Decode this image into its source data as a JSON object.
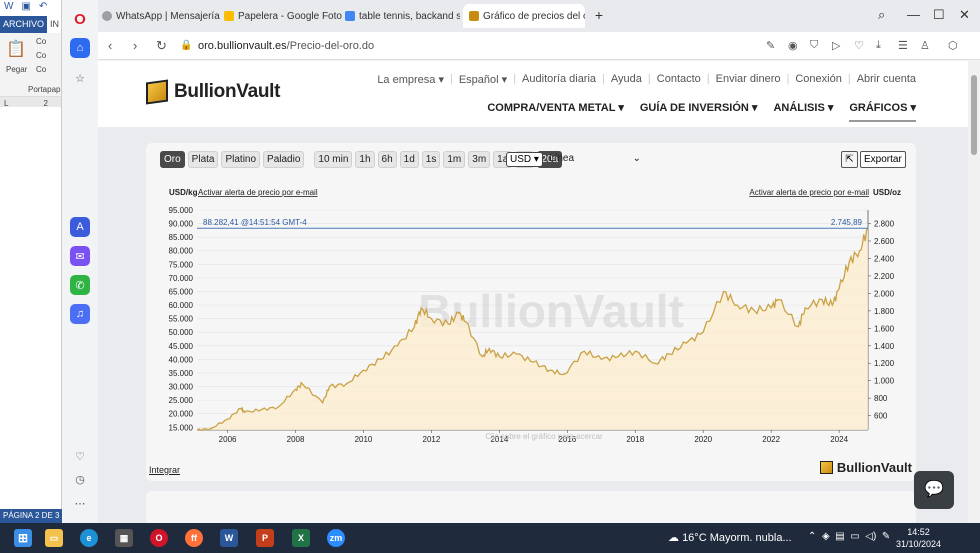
{
  "word": {
    "tab_file": "ARCHIVO",
    "tab_2": "IN",
    "paste_label": "Pegar",
    "clipboard_label": "Portapap",
    "cut_label": "Co",
    "copy_label": "Co",
    "format_label": "Co",
    "ruler_marker": "L",
    "ruler_num": "2",
    "status": "PÁGINA 2 DE 3"
  },
  "browser": {
    "tabs": [
      {
        "title": "WhatsApp | Mensajería y",
        "icon_color": "#9aa0a6"
      },
      {
        "title": "Papelera - Google Fotos",
        "icon_color": "#fbbc04"
      },
      {
        "title": "table tennis, backand serv",
        "icon_color": "#4285f4"
      },
      {
        "title": "Gráfico de precios del oro",
        "icon_color": "#c98a12"
      }
    ],
    "new_tab": "+",
    "url_domain": "oro.bullionvault.es",
    "url_path": "/Precio-del-oro.do"
  },
  "site": {
    "logo": "BullionVault",
    "topnav": [
      "La empresa ▾",
      "Español ▾",
      "Auditoría diaria",
      "Ayuda",
      "Contacto",
      "Enviar dinero",
      "Conexión",
      "Abrir cuenta"
    ],
    "mainnav": [
      "COMPRA/VENTA METAL ▾",
      "GUÍA DE INVERSIÓN ▾",
      "ANÁLISIS ▾",
      "GRÁFICOS ▾"
    ]
  },
  "chart_controls": {
    "metals": [
      "Oro",
      "Plata",
      "Platino",
      "Paladio"
    ],
    "ranges": [
      "10 min",
      "1h",
      "6h",
      "1d",
      "1s",
      "1m",
      "3m",
      "1a",
      "5a",
      "20a"
    ],
    "currency": "USD ▾",
    "chart_type": "Línea",
    "export": "Exportar",
    "integrar": "Integrar",
    "footer_logo": "BullionVault"
  },
  "chart_data": {
    "type": "area",
    "left_unit": "USD/kg",
    "right_unit": "USD/oz",
    "left_alert": "Activar alerta de precio por e-mail",
    "right_alert": "Activar alerta de precio por e-mail",
    "current_left": "88.282,41 @14:51:54 GMT-4",
    "current_right": "2.745,89",
    "watermark": "BullionVault",
    "hint": "Clic sobre el gráfico para acercar",
    "x_ticks": [
      "2006",
      "2008",
      "2010",
      "2012",
      "2014",
      "2016",
      "2018",
      "2020",
      "2022",
      "2024"
    ],
    "xlim": [
      2005.1,
      2024.85
    ],
    "ylim_left": [
      14000,
      95000
    ],
    "y_left_ticks": [
      "15.000",
      "20.000",
      "25.000",
      "30.000",
      "35.000",
      "40.000",
      "45.000",
      "50.000",
      "55.000",
      "60.000",
      "65.000",
      "70.000",
      "75.000",
      "80.000",
      "85.000",
      "90.000",
      "95.000"
    ],
    "y_right_ticks": [
      "600",
      "800",
      "1.000",
      "1.200",
      "1.400",
      "1.600",
      "1.800",
      "2.000",
      "2.200",
      "2.400",
      "2.600",
      "2.800"
    ],
    "series": [
      {
        "x": [
          2005.1,
          2005.5,
          2006.0,
          2006.4,
          2006.5,
          2007.0,
          2007.5,
          2008.0,
          2008.2,
          2008.8,
          2009.0,
          2009.5,
          2010.0,
          2010.5,
          2011.0,
          2011.5,
          2011.7,
          2012.0,
          2012.5,
          2012.8,
          2013.0,
          2013.5,
          2013.7,
          2014.0,
          2014.5,
          2015.0,
          2015.5,
          2015.9,
          2016.5,
          2017.0,
          2017.5,
          2018.0,
          2018.6,
          2019.0,
          2019.5,
          2020.0,
          2020.6,
          2021.0,
          2021.5,
          2022.0,
          2022.2,
          2022.8,
          2023.0,
          2023.5,
          2023.8,
          2024.0,
          2024.3,
          2024.6,
          2024.85
        ],
        "values": [
          14000,
          14500,
          18000,
          22000,
          20500,
          21500,
          22500,
          29000,
          31000,
          24000,
          30000,
          31000,
          36000,
          40000,
          45000,
          52000,
          59000,
          55000,
          53000,
          57000,
          54000,
          41000,
          44000,
          41000,
          42000,
          39000,
          36000,
          34500,
          43000,
          40000,
          41000,
          43000,
          38500,
          42000,
          46000,
          50000,
          65000,
          60000,
          58000,
          59000,
          62000,
          52000,
          59000,
          62000,
          60000,
          66000,
          76000,
          80000,
          88282
        ]
      }
    ],
    "grid": true
  },
  "chat_icon": "chat-icon",
  "taskbar": {
    "weather": "16°C  Mayorm. nubla...",
    "time": "14:52",
    "date": "31/10/2024"
  }
}
